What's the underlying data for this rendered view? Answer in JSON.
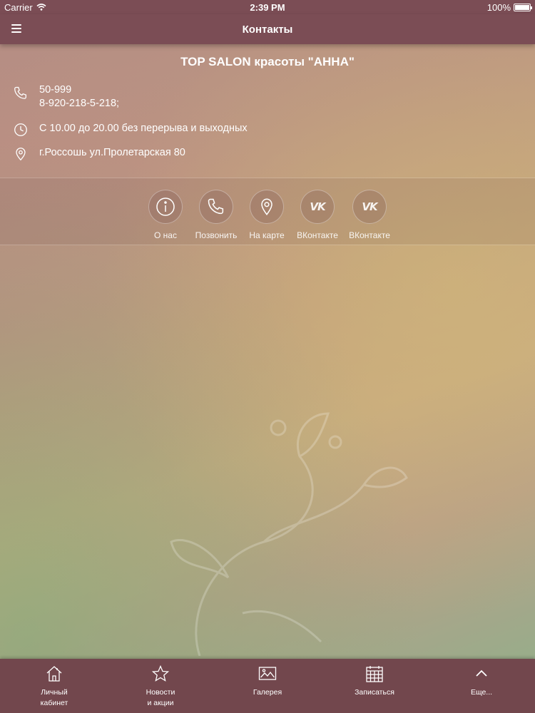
{
  "status": {
    "carrier": "Carrier",
    "time": "2:39 PM",
    "battery": "100%"
  },
  "nav": {
    "title": "Контакты"
  },
  "salon": {
    "name": "TOP SALON красоты \"АННА\""
  },
  "contacts": {
    "phone_line1": "50-999",
    "phone_line2": "8-920-218-5-218;",
    "hours": "С 10.00 до 20.00 без перерыва и выходных",
    "address": "г.Россошь ул.Пролетарская 80"
  },
  "actions": [
    {
      "label": "О нас",
      "icon": "info-icon"
    },
    {
      "label": "Позвонить",
      "icon": "phone-icon"
    },
    {
      "label": "На карте",
      "icon": "map-pin-icon"
    },
    {
      "label": "ВКонтакте",
      "icon": "vk-icon"
    },
    {
      "label": "ВКонтакте",
      "icon": "vk-icon"
    }
  ],
  "vk_logo": "VK",
  "tabs": [
    {
      "line1": "Личный",
      "line2": "кабинет",
      "icon": "home-icon"
    },
    {
      "line1": "Новости",
      "line2": "и акции",
      "icon": "star-icon"
    },
    {
      "line1": "Галерея",
      "line2": "",
      "icon": "gallery-icon"
    },
    {
      "line1": "Записаться",
      "line2": "",
      "icon": "calendar-icon"
    },
    {
      "line1": "Еще...",
      "line2": "",
      "icon": "chevron-up-icon"
    }
  ],
  "colors": {
    "bar": "#7b4d55",
    "tabbar": "#72474d",
    "text": "#ffffff"
  }
}
